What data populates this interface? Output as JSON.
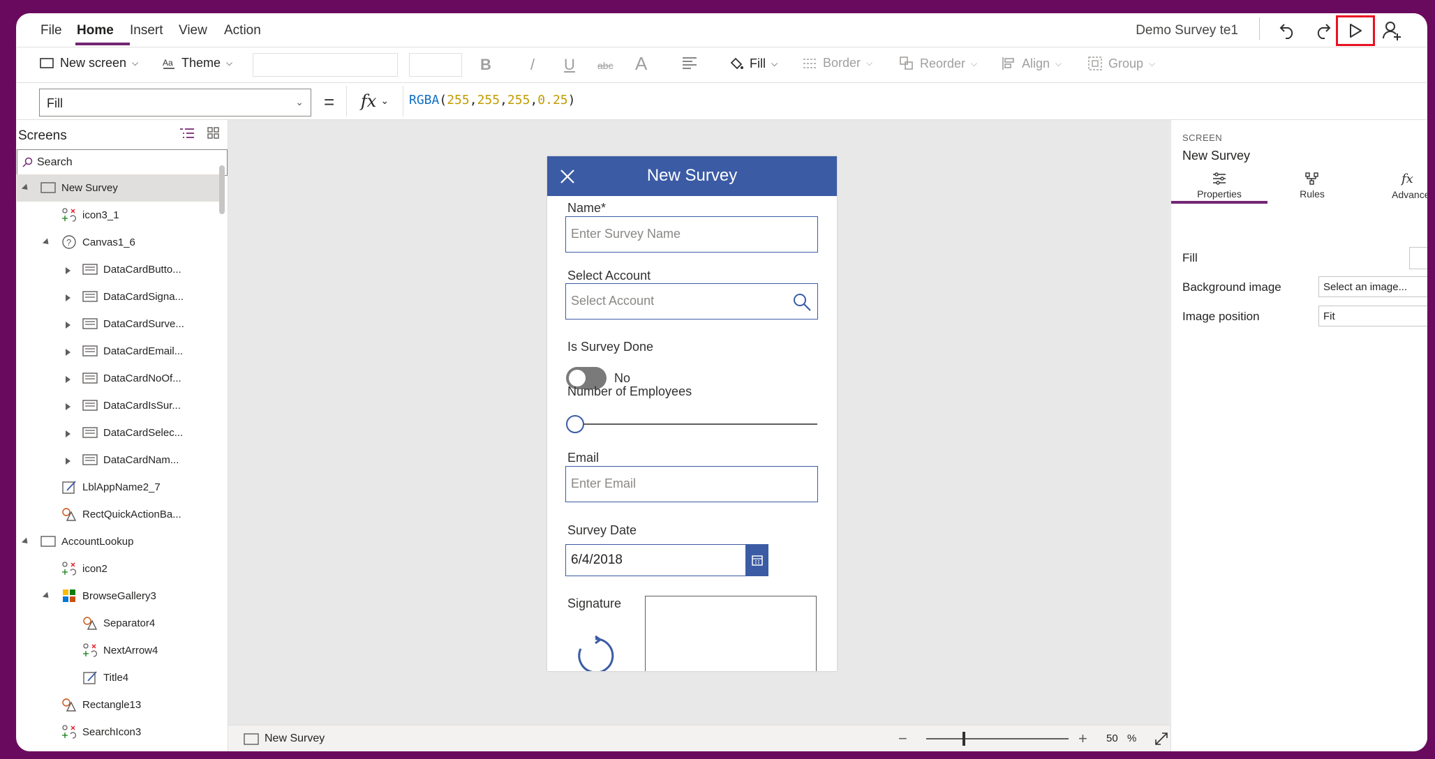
{
  "menu": {
    "file": "File",
    "home": "Home",
    "insert": "Insert",
    "view": "View",
    "action": "Action",
    "app_title": "Demo Survey te1"
  },
  "ribbon": {
    "new_screen": "New screen",
    "theme": "Theme",
    "bold": "B",
    "italic": "/",
    "underline": "U",
    "strike": "abc",
    "font_color": "A",
    "fill": "Fill",
    "border": "Border",
    "reorder": "Reorder",
    "align": "Align",
    "group": "Group"
  },
  "formula_bar": {
    "property": "Fill",
    "equals": "=",
    "fx": "fx",
    "fn": "RGBA",
    "open": "(",
    "a1": "255",
    "a2": "255",
    "a3": "255",
    "a4": "0.25",
    "comma": ",",
    "close": ")"
  },
  "left_pane": {
    "title": "Screens",
    "search_placeholder": "Search",
    "tree": [
      {
        "label": "New Survey",
        "type": "screen"
      },
      {
        "label": "icon3_1",
        "type": "icon"
      },
      {
        "label": "Canvas1_6",
        "type": "canvas"
      },
      {
        "label": "DataCardButto...",
        "type": "card"
      },
      {
        "label": "DataCardSigna...",
        "type": "card"
      },
      {
        "label": "DataCardSurve...",
        "type": "card"
      },
      {
        "label": "DataCardEmail...",
        "type": "card"
      },
      {
        "label": "DataCardNoOf...",
        "type": "card"
      },
      {
        "label": "DataCardIsSur...",
        "type": "card"
      },
      {
        "label": "DataCardSelec...",
        "type": "card"
      },
      {
        "label": "DataCardNam...",
        "type": "card"
      },
      {
        "label": "LblAppName2_7",
        "type": "label"
      },
      {
        "label": "RectQuickActionBa...",
        "type": "shape"
      },
      {
        "label": "AccountLookup",
        "type": "screen"
      },
      {
        "label": "icon2",
        "type": "icon"
      },
      {
        "label": "BrowseGallery3",
        "type": "gallery"
      },
      {
        "label": "Separator4",
        "type": "shape"
      },
      {
        "label": "NextArrow4",
        "type": "icon"
      },
      {
        "label": "Title4",
        "type": "label"
      },
      {
        "label": "Rectangle13",
        "type": "shape"
      },
      {
        "label": "SearchIcon3",
        "type": "icon"
      }
    ]
  },
  "phone": {
    "title": "New Survey",
    "name_label": "Name*",
    "name_placeholder": "Enter Survey Name",
    "account_label": "Select Account",
    "account_placeholder": "Select Account",
    "done_label": "Is Survey Done",
    "done_value": "No",
    "employees_label": "Number of Employees",
    "email_label": "Email",
    "email_placeholder": "Enter Email",
    "date_label": "Survey Date",
    "date_value": "6/4/2018",
    "signature_label": "Signature"
  },
  "bottom_bar": {
    "screen_name": "New Survey",
    "minus": "−",
    "plus": "+",
    "zoom": "50",
    "percent": "%"
  },
  "right_pane": {
    "section": "SCREEN",
    "name": "New Survey",
    "tab_properties": "Properties",
    "tab_rules": "Rules",
    "tab_advanced": "Advanced",
    "fill_label": "Fill",
    "bg_label": "Background image",
    "bg_value": "Select an image...",
    "pos_label": "Image position",
    "pos_value": "Fit"
  },
  "colors": {
    "accent": "#742774",
    "header_blue": "#3b5ba5",
    "highlight": "#e81123"
  }
}
